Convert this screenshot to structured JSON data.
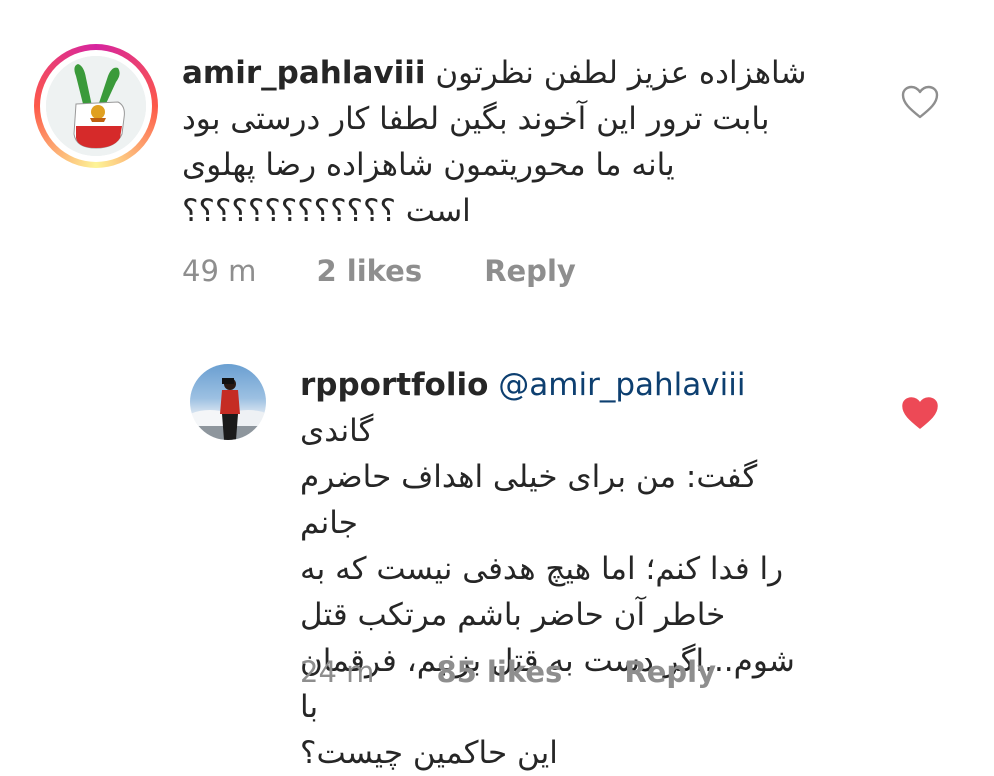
{
  "comments": [
    {
      "username": "amir_pahlaviii",
      "first_line_text": "شاهزاده عزیز لطفن نظرتون",
      "lines": [
        "بابت ترور این آخوند بگین لطفا کار درستی بود",
        "یانه ما محوریتمون شاهزاده رضا پهلوی",
        "است ؟؟؟؟؟؟؟؟؟؟؟؟؟"
      ],
      "time": "49 m",
      "likes": "2 likes",
      "reply_label": "Reply",
      "liked": false
    },
    {
      "username": "rpportfolio",
      "mention": "@amir_pahlaviii",
      "first_line_text": "گاندی",
      "lines": [
        "گفت: من برای خیلی اهداف حاضرم جانم",
        "را فدا کنم؛ اما هیچ هدفی نیست که به",
        "خاطر آن حاضر باشم مرتکب قتل",
        "شوم...اگر دست به قتل بزنیم، فرقمان با",
        "این حاکمین چیست؟"
      ],
      "time": "24 m",
      "likes": "85 likes",
      "reply_label": "Reply",
      "liked": true
    }
  ],
  "colors": {
    "like_red": "#ed4956",
    "meta_gray": "#8e8e8e",
    "mention_blue": "#0d3f70"
  }
}
